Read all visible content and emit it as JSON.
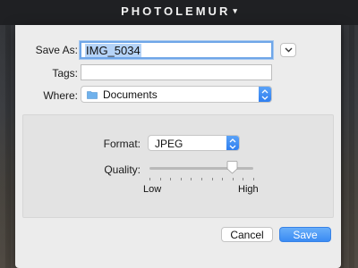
{
  "app": {
    "title": "PHOTOLEMUR",
    "menu_caret": "▾"
  },
  "dialog": {
    "save_as": {
      "label": "Save As:",
      "value": "IMG_5034"
    },
    "tags": {
      "label": "Tags:",
      "value": ""
    },
    "where": {
      "label": "Where:",
      "value": "Documents",
      "icon": "folder-icon"
    },
    "format": {
      "label": "Format:",
      "value": "JPEG"
    },
    "quality": {
      "label": "Quality:",
      "low_label": "Low",
      "high_label": "High",
      "level_fraction": 0.8,
      "ticks": 11
    },
    "buttons": {
      "cancel": "Cancel",
      "save": "Save"
    }
  },
  "colors": {
    "accent": "#3a8bf3",
    "selection": "#b5d3f7",
    "sheet_bg": "#ececec"
  }
}
